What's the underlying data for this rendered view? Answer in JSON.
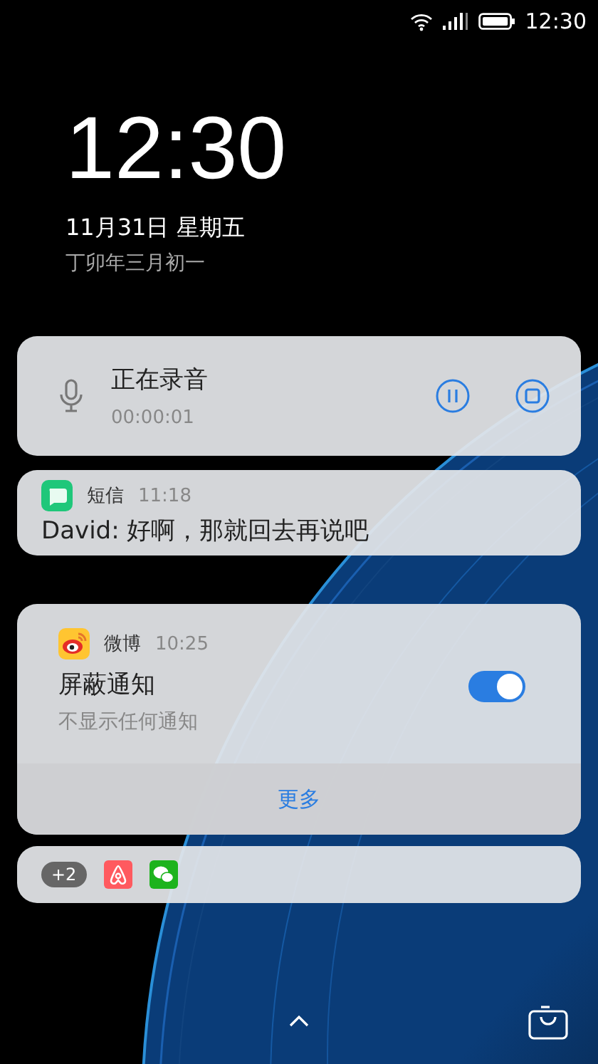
{
  "status_bar": {
    "time": "12:30"
  },
  "lock_clock": {
    "time": "12:30",
    "date": "11月31日 星期五",
    "lunar_date": "丁卯年三月初一"
  },
  "recording": {
    "title": "正在录音",
    "elapsed": "00:00:01"
  },
  "sms": {
    "app": "短信",
    "time": "11:18",
    "message": "David: 好啊，那就回去再说吧"
  },
  "weibo": {
    "app": "微博",
    "time": "10:25",
    "title": "屏蔽通知",
    "subtitle": "不显示任何通知",
    "on": true,
    "more": "更多"
  },
  "overflow": {
    "count": "+2"
  }
}
